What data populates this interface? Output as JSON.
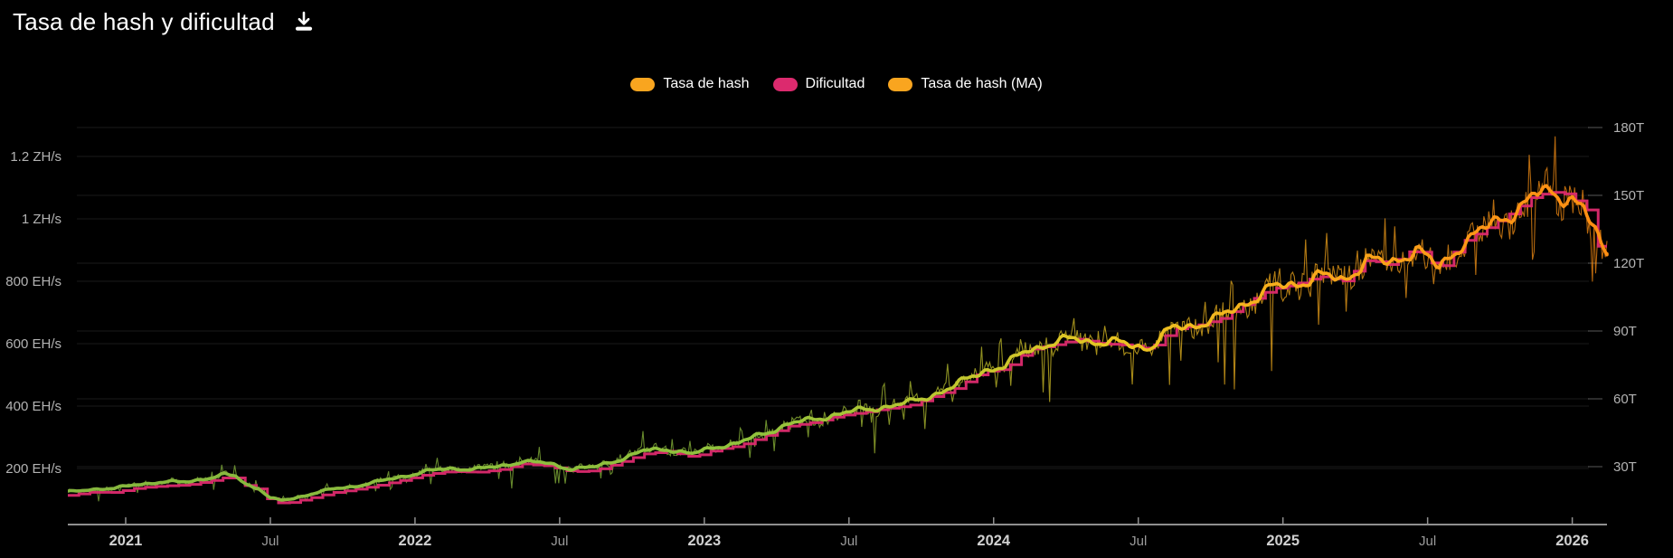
{
  "header": {
    "title": "Tasa de hash y dificultad",
    "download_icon": "download-icon"
  },
  "legend": {
    "items": [
      {
        "label": "Tasa de hash",
        "color": "#F9A51F"
      },
      {
        "label": "Dificultad",
        "color": "#DC2A6E"
      },
      {
        "label": "Tasa de hash (MA)",
        "color": "#F9A51F"
      }
    ]
  },
  "chart_data": {
    "type": "line",
    "title": "Tasa de hash y dificultad",
    "x_range_years": [
      2020.8,
      2026.12
    ],
    "x_ticks": [
      {
        "t": 2021.0,
        "label": "2021",
        "bold": true
      },
      {
        "t": 2021.5,
        "label": "Jul",
        "bold": false
      },
      {
        "t": 2022.0,
        "label": "2022",
        "bold": true
      },
      {
        "t": 2022.5,
        "label": "Jul",
        "bold": false
      },
      {
        "t": 2023.0,
        "label": "2023",
        "bold": true
      },
      {
        "t": 2023.5,
        "label": "Jul",
        "bold": false
      },
      {
        "t": 2024.0,
        "label": "2024",
        "bold": true
      },
      {
        "t": 2024.5,
        "label": "Jul",
        "bold": false
      },
      {
        "t": 2025.0,
        "label": "2025",
        "bold": true
      },
      {
        "t": 2025.5,
        "label": "Jul",
        "bold": false
      },
      {
        "t": 2026.0,
        "label": "2026",
        "bold": true
      }
    ],
    "left_axis": {
      "name": "hashrate",
      "unit": "EH/s",
      "ticks": [
        {
          "value": 1200,
          "label": "1.2 ZH/s"
        },
        {
          "value": 1000,
          "label": "1 ZH/s"
        },
        {
          "value": 800,
          "label": "800 EH/s"
        },
        {
          "value": 600,
          "label": "600 EH/s"
        },
        {
          "value": 400,
          "label": "400 EH/s"
        },
        {
          "value": 200,
          "label": "200 EH/s"
        }
      ]
    },
    "right_axis": {
      "name": "difficulty",
      "unit": "T",
      "ticks": [
        {
          "value": 180,
          "label": "180T"
        },
        {
          "value": 150,
          "label": "150T"
        },
        {
          "value": 120,
          "label": "120T"
        },
        {
          "value": 90,
          "label": "90T"
        },
        {
          "value": 60,
          "label": "60T"
        },
        {
          "value": 30,
          "label": "30T"
        }
      ]
    },
    "series": [
      {
        "name": "Tasa de hash (MA)",
        "unit": "EH/s",
        "axis": "left",
        "points": [
          [
            2020.8,
            124
          ],
          [
            2020.88,
            134
          ],
          [
            2020.96,
            135
          ],
          [
            2021.04,
            150
          ],
          [
            2021.12,
            155
          ],
          [
            2021.21,
            158
          ],
          [
            2021.26,
            166
          ],
          [
            2021.3,
            170
          ],
          [
            2021.34,
            180
          ],
          [
            2021.38,
            176
          ],
          [
            2021.42,
            148
          ],
          [
            2021.46,
            136
          ],
          [
            2021.5,
            104
          ],
          [
            2021.54,
            98
          ],
          [
            2021.58,
            104
          ],
          [
            2021.62,
            114
          ],
          [
            2021.71,
            133
          ],
          [
            2021.79,
            143
          ],
          [
            2021.87,
            157
          ],
          [
            2021.96,
            175
          ],
          [
            2022.04,
            191
          ],
          [
            2022.12,
            200
          ],
          [
            2022.21,
            198
          ],
          [
            2022.29,
            206
          ],
          [
            2022.37,
            223
          ],
          [
            2022.46,
            216
          ],
          [
            2022.54,
            199
          ],
          [
            2022.62,
            204
          ],
          [
            2022.71,
            230
          ],
          [
            2022.79,
            256
          ],
          [
            2022.87,
            263
          ],
          [
            2022.96,
            246
          ],
          [
            2023.04,
            270
          ],
          [
            2023.12,
            282
          ],
          [
            2023.21,
            313
          ],
          [
            2023.29,
            343
          ],
          [
            2023.37,
            355
          ],
          [
            2023.46,
            375
          ],
          [
            2023.54,
            386
          ],
          [
            2023.62,
            398
          ],
          [
            2023.71,
            410
          ],
          [
            2023.79,
            437
          ],
          [
            2023.87,
            464
          ],
          [
            2023.96,
            515
          ],
          [
            2024.04,
            525
          ],
          [
            2024.12,
            585
          ],
          [
            2024.21,
            601
          ],
          [
            2024.29,
            618
          ],
          [
            2024.37,
            604
          ],
          [
            2024.46,
            599
          ],
          [
            2024.54,
            588
          ],
          [
            2024.62,
            649
          ],
          [
            2024.71,
            664
          ],
          [
            2024.79,
            686
          ],
          [
            2024.87,
            732
          ],
          [
            2024.96,
            777
          ],
          [
            2025.04,
            791
          ],
          [
            2025.12,
            817
          ],
          [
            2025.21,
            803
          ],
          [
            2025.29,
            871
          ],
          [
            2025.37,
            853
          ],
          [
            2025.46,
            908
          ],
          [
            2025.54,
            838
          ],
          [
            2025.62,
            926
          ],
          [
            2025.71,
            973
          ],
          [
            2025.79,
            1020
          ],
          [
            2025.87,
            1074
          ],
          [
            2025.93,
            1085
          ],
          [
            2026.0,
            1066
          ],
          [
            2026.04,
            1030
          ],
          [
            2026.07,
            968
          ],
          [
            2026.1,
            915
          ],
          [
            2026.12,
            888
          ]
        ]
      },
      {
        "name": "Dificultad",
        "unit": "T",
        "axis": "right",
        "step_days": 14,
        "points": [
          [
            2020.8,
            17.3
          ],
          [
            2020.88,
            18.7
          ],
          [
            2020.96,
            18.6
          ],
          [
            2021.04,
            20.6
          ],
          [
            2021.12,
            21.4
          ],
          [
            2021.21,
            21.9
          ],
          [
            2021.26,
            23.0
          ],
          [
            2021.29,
            23.6
          ],
          [
            2021.33,
            25.0
          ],
          [
            2021.38,
            25.0
          ],
          [
            2021.42,
            21.0
          ],
          [
            2021.46,
            19.9
          ],
          [
            2021.5,
            14.4
          ],
          [
            2021.55,
            13.7
          ],
          [
            2021.62,
            15.6
          ],
          [
            2021.71,
            18.4
          ],
          [
            2021.79,
            19.9
          ],
          [
            2021.87,
            21.7
          ],
          [
            2021.96,
            24.2
          ],
          [
            2022.04,
            26.6
          ],
          [
            2022.12,
            27.9
          ],
          [
            2022.21,
            27.5
          ],
          [
            2022.29,
            28.6
          ],
          [
            2022.37,
            31.2
          ],
          [
            2022.46,
            30.3
          ],
          [
            2022.54,
            27.7
          ],
          [
            2022.62,
            28.2
          ],
          [
            2022.71,
            32.0
          ],
          [
            2022.79,
            35.6
          ],
          [
            2022.87,
            36.8
          ],
          [
            2022.96,
            34.2
          ],
          [
            2023.04,
            37.6
          ],
          [
            2023.12,
            39.2
          ],
          [
            2023.21,
            43.6
          ],
          [
            2023.29,
            47.9
          ],
          [
            2023.37,
            49.5
          ],
          [
            2023.46,
            52.4
          ],
          [
            2023.54,
            53.9
          ],
          [
            2023.62,
            55.6
          ],
          [
            2023.71,
            57.1
          ],
          [
            2023.79,
            61.0
          ],
          [
            2023.87,
            64.7
          ],
          [
            2023.96,
            72.0
          ],
          [
            2024.04,
            73.2
          ],
          [
            2024.12,
            81.7
          ],
          [
            2024.21,
            83.9
          ],
          [
            2024.29,
            86.4
          ],
          [
            2024.37,
            84.4
          ],
          [
            2024.46,
            83.7
          ],
          [
            2024.54,
            82.0
          ],
          [
            2024.62,
            90.7
          ],
          [
            2024.71,
            92.7
          ],
          [
            2024.79,
            95.7
          ],
          [
            2024.87,
            102.3
          ],
          [
            2024.96,
            108.5
          ],
          [
            2025.04,
            110.5
          ],
          [
            2025.12,
            114.2
          ],
          [
            2025.21,
            112.1
          ],
          [
            2025.29,
            121.7
          ],
          [
            2025.37,
            119.1
          ],
          [
            2025.46,
            126.9
          ],
          [
            2025.54,
            116.9
          ],
          [
            2025.62,
            129.4
          ],
          [
            2025.71,
            136.0
          ],
          [
            2025.79,
            142.3
          ],
          [
            2025.87,
            150.0
          ],
          [
            2025.96,
            151.8
          ],
          [
            2026.02,
            147.0
          ],
          [
            2026.065,
            142.0
          ],
          [
            2026.072,
            127.5
          ],
          [
            2026.12,
            127.5
          ]
        ]
      },
      {
        "name": "Tasa de hash",
        "unit": "EH/s",
        "axis": "left",
        "note": "raw daily hashrate, noisy band around the MA series"
      }
    ]
  },
  "style": {
    "background": "#000000",
    "grid_color": "rgba(255,255,255,0.10)",
    "axis_line_color": "#8f8f8f",
    "axis_label_color": "#b3b3b3",
    "x_year_color": "#d0d0d0",
    "x_month_color": "#9b9b9b",
    "difficulty_color": "#DC2A6E",
    "hashrate_gradient": [
      [
        0,
        "#86B63E"
      ],
      [
        0.45,
        "#92C23D"
      ],
      [
        0.58,
        "#C2C72F"
      ],
      [
        0.68,
        "#E9C522"
      ],
      [
        0.8,
        "#F9AB1B"
      ],
      [
        0.92,
        "#FC9616"
      ],
      [
        1,
        "#FF8E12"
      ]
    ],
    "noise": {
      "seed": 1337,
      "sample_step_years": 0.0056,
      "base_jitter": 0.11,
      "down_spike_prob": 0.055,
      "deep_spike_prob": 0.012,
      "up_spike_prob": 0.05,
      "wiggle": [
        [
          0.018,
          34.6,
          1.3
        ],
        [
          0.012,
          71.3,
          4.0
        ],
        [
          0.008,
          143.0,
          2.2
        ]
      ]
    }
  }
}
